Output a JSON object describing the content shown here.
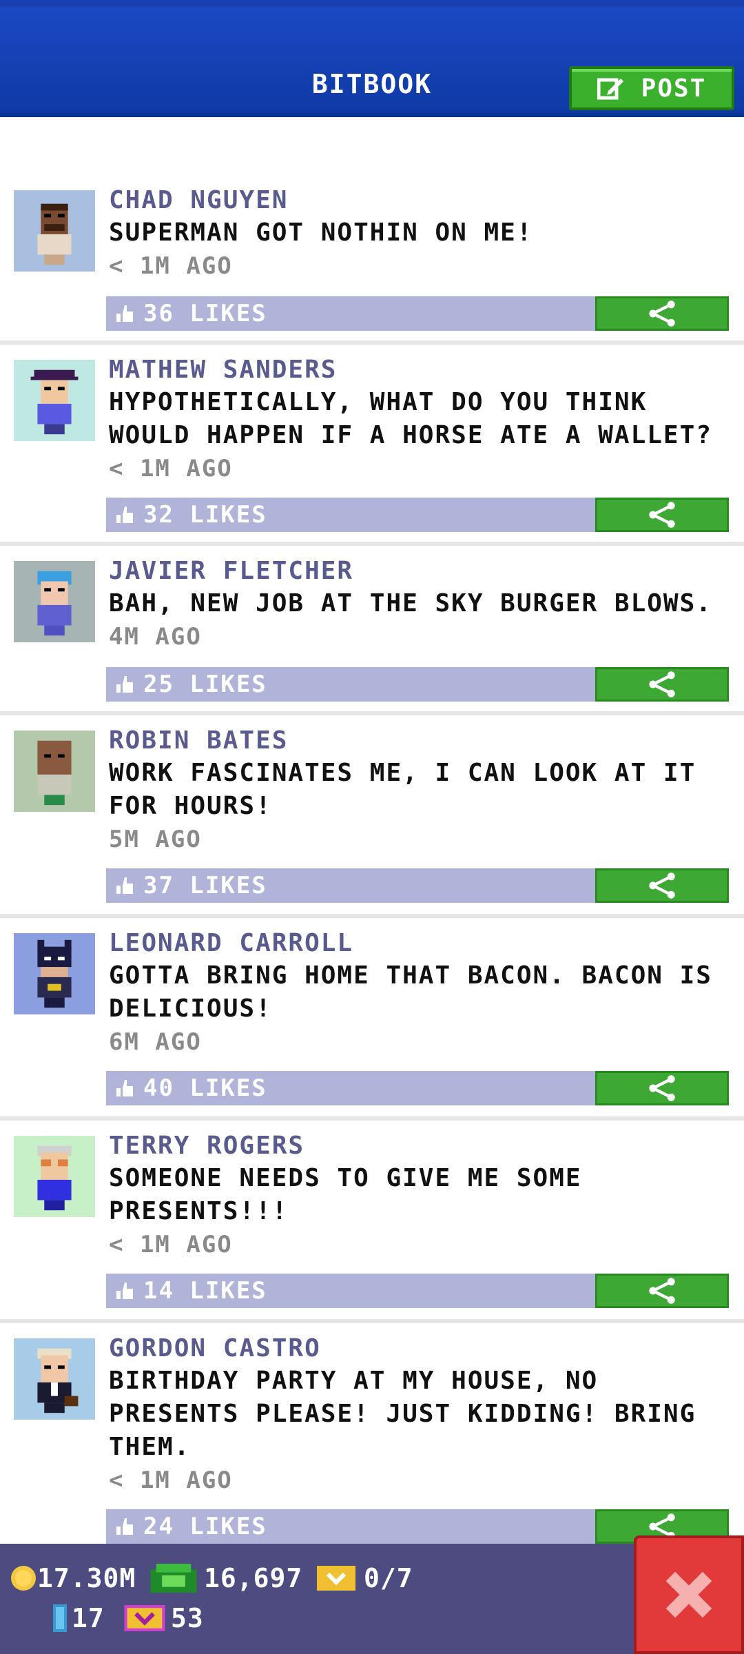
{
  "header": {
    "title": "BITBOOK",
    "post_label": "POST"
  },
  "posts": [
    {
      "name": "CHAD NGUYEN",
      "message": "SUPERMAN GOT NOTHIN ON ME!",
      "time": "< 1M AGO",
      "likes": "36 LIKES",
      "avatar_bg": "#a8bfe0"
    },
    {
      "name": "MATHEW SANDERS",
      "message": "HYPOTHETICALLY, WHAT DO YOU THINK WOULD HAPPEN IF A HORSE ATE A WALLET?",
      "time": "< 1M AGO",
      "likes": "32 LIKES",
      "avatar_bg": "#c0e8e2"
    },
    {
      "name": "JAVIER FLETCHER",
      "message": "BAH, NEW JOB AT THE SKY BURGER BLOWS.",
      "time": "4M AGO",
      "likes": "25 LIKES",
      "avatar_bg": "#a6b4b4"
    },
    {
      "name": "ROBIN BATES",
      "message": "WORK FASCINATES ME, I CAN LOOK AT IT FOR HOURS!",
      "time": "5M AGO",
      "likes": "37 LIKES",
      "avatar_bg": "#b4c8ac"
    },
    {
      "name": "LEONARD CARROLL",
      "message": "GOTTA BRING HOME THAT BACON. BACON IS DELICIOUS!",
      "time": "6M AGO",
      "likes": "40 LIKES",
      "avatar_bg": "#8b9ee0"
    },
    {
      "name": "TERRY ROGERS",
      "message": "SOMEONE NEEDS TO GIVE ME SOME PRESENTS!!!",
      "time": "< 1M AGO",
      "likes": "14 LIKES",
      "avatar_bg": "#c8f0c8"
    },
    {
      "name": "GORDON CASTRO",
      "message": "BIRTHDAY PARTY AT MY HOUSE, NO PRESENTS PLEASE! JUST KIDDING! BRING THEM.",
      "time": "< 1M AGO",
      "likes": "24 LIKES",
      "avatar_bg": "#a8cce8"
    }
  ],
  "footer": {
    "coins": "17.30M",
    "bux": "16,697",
    "tickets": "0/7",
    "elevator": "17",
    "vip": "53"
  },
  "colors": {
    "header_blue": "#1b49c4",
    "accent_green": "#3da833",
    "like_bar": "#b1b3d8",
    "name_purple": "#5a5a8e",
    "footer": "#4d4b80",
    "close_red": "#e23a3a"
  }
}
